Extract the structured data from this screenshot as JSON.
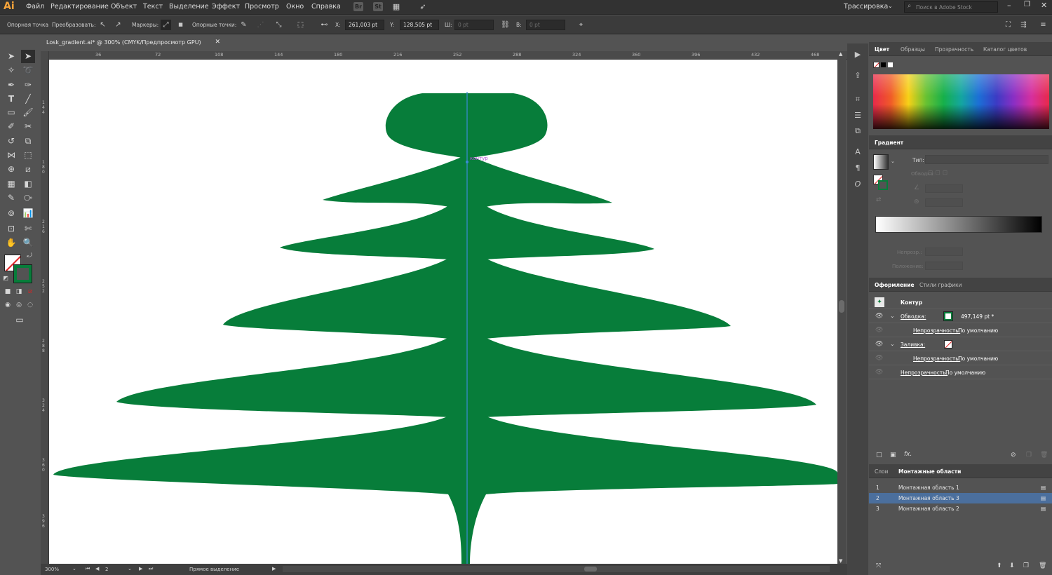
{
  "app": {
    "logo": "Ai"
  },
  "menu": [
    "Файл",
    "Редактирование",
    "Объект",
    "Текст",
    "Выделение",
    "Эффект",
    "Просмотр",
    "Окно",
    "Справка"
  ],
  "menubar_icons": {
    "bridge": "Br",
    "stock": "St"
  },
  "workspace": "Трассировка",
  "search_placeholder": "Поиск в Adobe Stock",
  "control": {
    "anchor_point": "Опорная точка",
    "convert": "Преобразовать:",
    "handles": "Маркеры:",
    "anchors": "Опорные точки:",
    "x_label": "X:",
    "x_value": "261,003 pt",
    "y_label": "Y:",
    "y_value": "128,505 pt",
    "w_label": "Ш:",
    "w_value": "0 pt",
    "h_label": "В:",
    "h_value": "0 pt"
  },
  "document_tab": "Losk_gradient.ai* @ 300% (CMYK/Предпросмотр GPU)",
  "ruler_h": [
    "36",
    "72",
    "108",
    "144",
    "180",
    "216",
    "252",
    "288",
    "324",
    "360",
    "396",
    "432",
    "468"
  ],
  "ruler_v": [
    "144",
    "180",
    "216",
    "252",
    "288",
    "324",
    "360",
    "396"
  ],
  "canvas": {
    "path_label": "контур",
    "tree_color": "#077d3a",
    "guide_color": "#3b8bd6"
  },
  "status": {
    "zoom": "300%",
    "artboard": "2",
    "tool": "Прямое выделение"
  },
  "panel": {
    "color_tabs": [
      "Цвет",
      "Образцы",
      "Прозрачность",
      "Каталог цветов"
    ],
    "gradient": {
      "title": "Градиент",
      "type_label": "Тип:",
      "stroke_label": "Обводка:",
      "opacity_label": "Непрозр.:",
      "position_label": "Положение:"
    },
    "appearance_tabs": [
      "Оформление",
      "Стили графики"
    ],
    "appearance": {
      "object": "Контур",
      "stroke_label": "Обводка:",
      "stroke_value": "497,149 pt *",
      "opacity_label": "Непрозрачность:",
      "opacity_value": "По умолчанию",
      "fill_label": "Заливка:",
      "stroke_color": "#077d3a"
    },
    "layer_tabs": [
      "Слои",
      "Монтажные области"
    ],
    "artboards": [
      {
        "num": "1",
        "name": "Монтажная область 1"
      },
      {
        "num": "2",
        "name": "Монтажная область 3"
      },
      {
        "num": "3",
        "name": "Монтажная область 2"
      }
    ]
  }
}
